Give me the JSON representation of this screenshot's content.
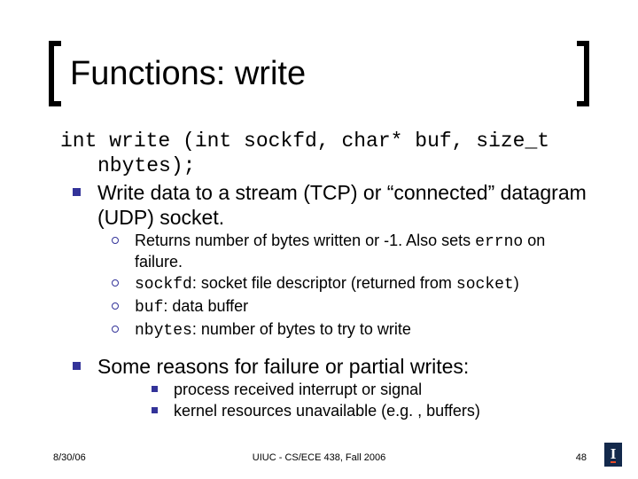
{
  "title": "Functions: write",
  "signature": {
    "line1": "int write (int sockfd, char* buf, size_t",
    "line2": "nbytes);"
  },
  "p1": {
    "text": "Write data to a stream (TCP) or “connected” datagram (UDP) socket.",
    "subs": [
      {
        "pre": "Returns number of bytes written or -1. Also sets ",
        "code": "errno",
        "post": " on failure."
      },
      {
        "code": "sockfd",
        "post": ": socket file descriptor (returned from ",
        "code2": "socket",
        "post2": ")"
      },
      {
        "code": "buf",
        "post": ": data buffer"
      },
      {
        "code": "nbytes",
        "post": ": number of bytes to try to write"
      }
    ]
  },
  "p2": {
    "text": "Some reasons for failure or partial writes:",
    "subs": [
      {
        "text": "process received interrupt or signal"
      },
      {
        "text": "kernel resources unavailable (e.g. , buffers)"
      }
    ]
  },
  "footer": {
    "date": "8/30/06",
    "mid": "UIUC - CS/ECE 438, Fall 2006",
    "page": "48"
  },
  "logo": {
    "letter": "I"
  }
}
